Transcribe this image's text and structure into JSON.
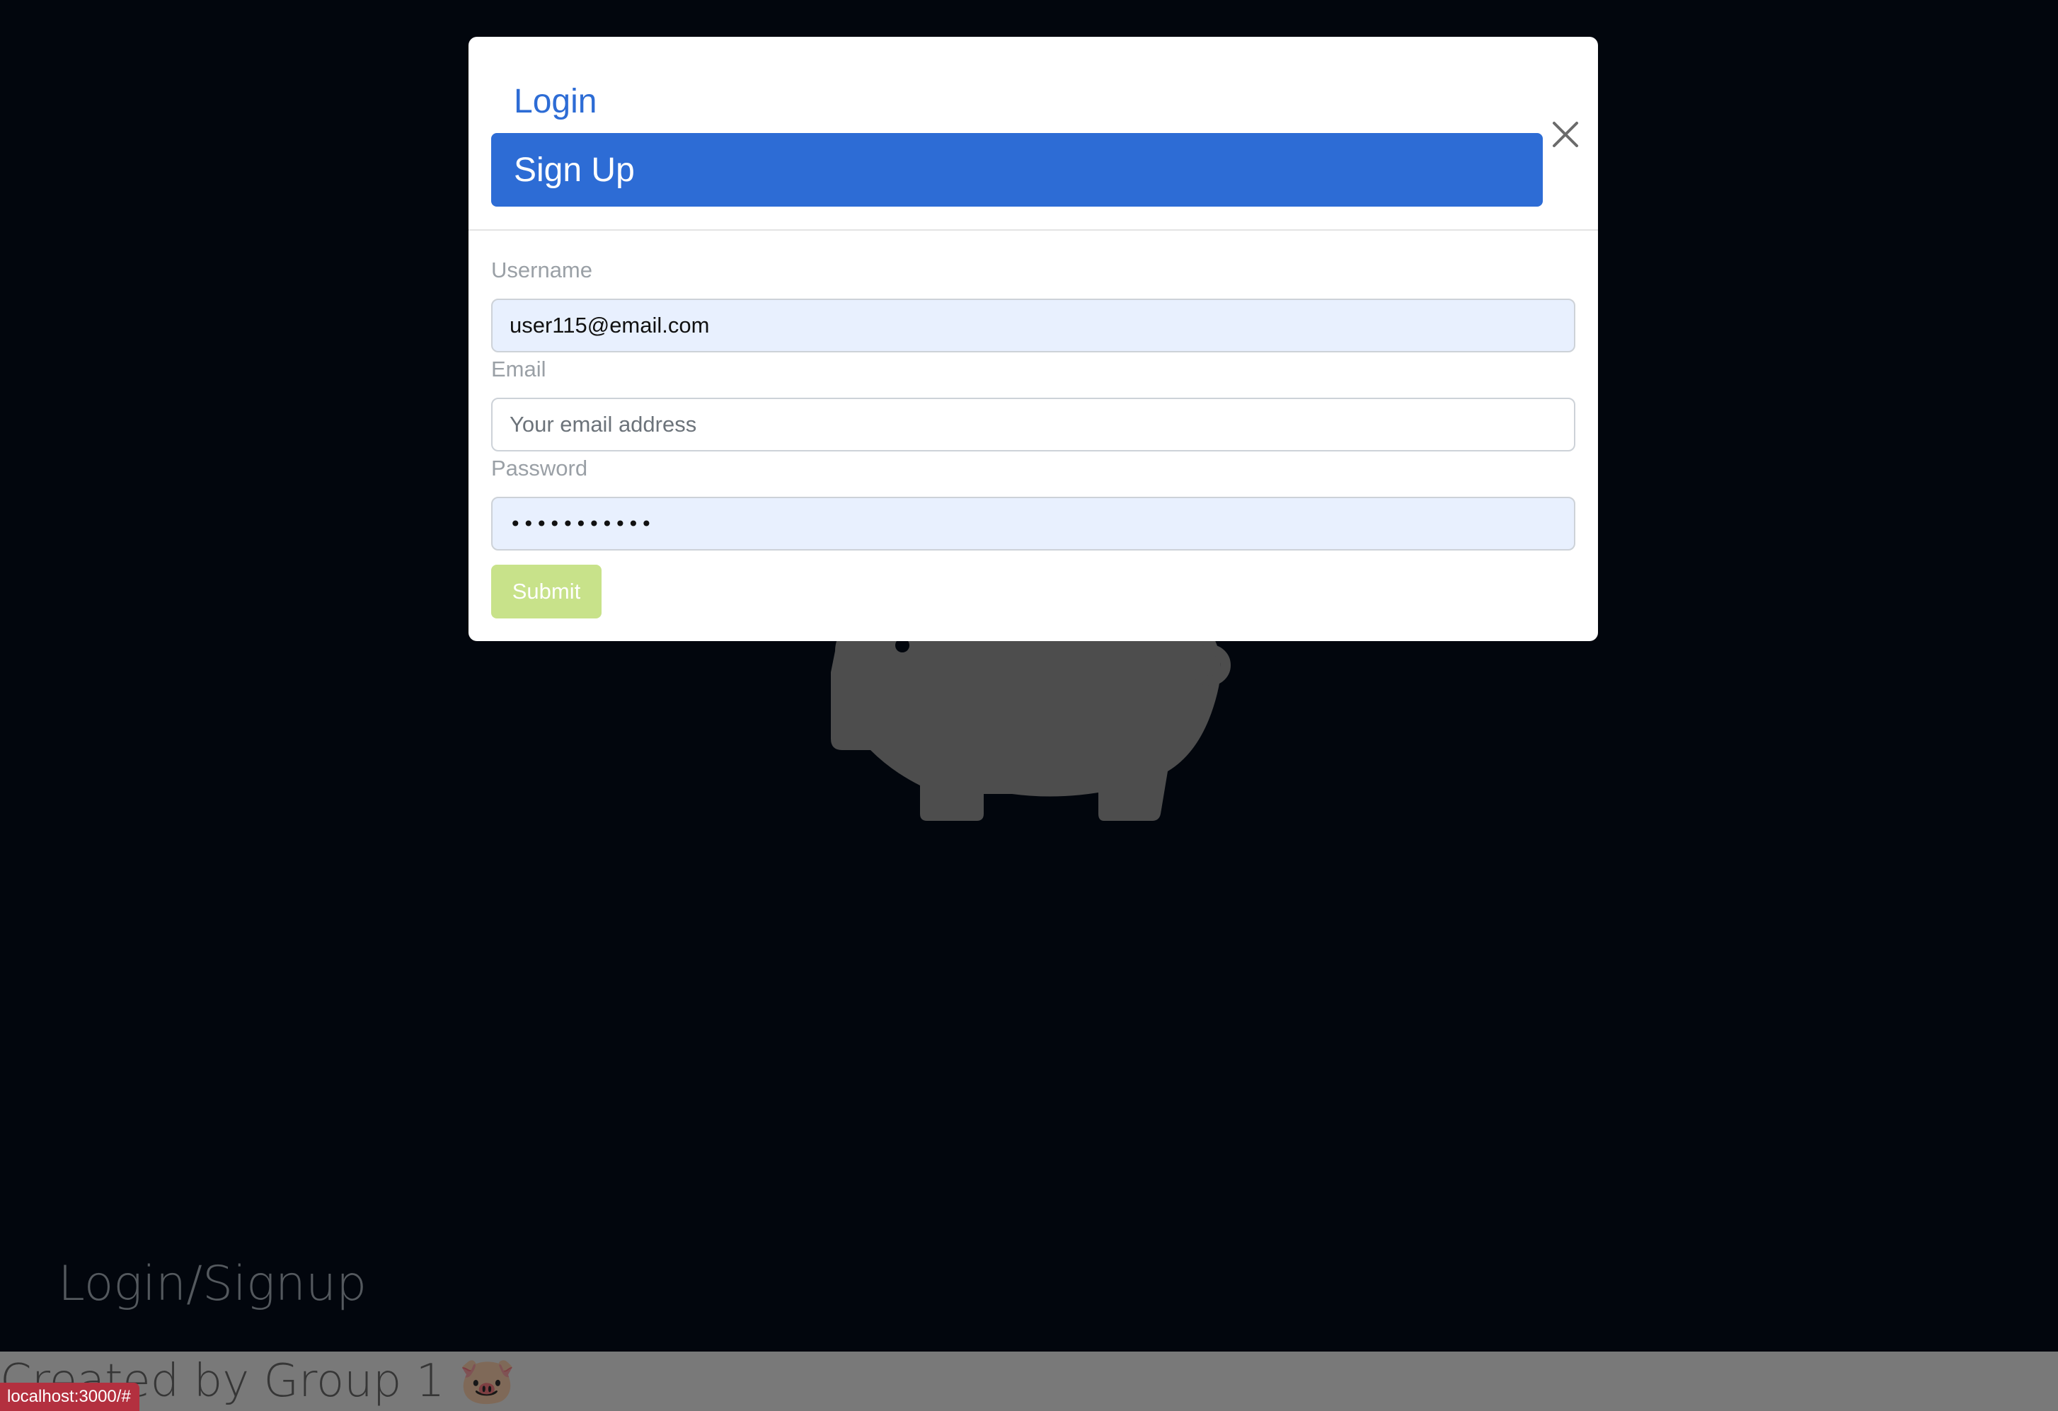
{
  "modal": {
    "tabs": {
      "login_label": "Login",
      "signup_label": "Sign Up"
    },
    "close_icon": "close-icon",
    "form": {
      "username_label": "Username",
      "username_value": "user115@email.com",
      "email_label": "Email",
      "email_placeholder": "Your email address",
      "password_label": "Password",
      "password_value": "•••••••••••",
      "submit_label": "Submit"
    }
  },
  "background": {
    "login_signup_link": "Login/Signup",
    "footer_text": "Created by Group 1 🐷",
    "logo_icon": "piggy-bank-icon"
  },
  "status_bar": {
    "url": "localhost:3000/#"
  },
  "colors": {
    "primary": "#2d6cd5",
    "submit_disabled": "#c8e28a",
    "page_background": "#040c1b"
  }
}
